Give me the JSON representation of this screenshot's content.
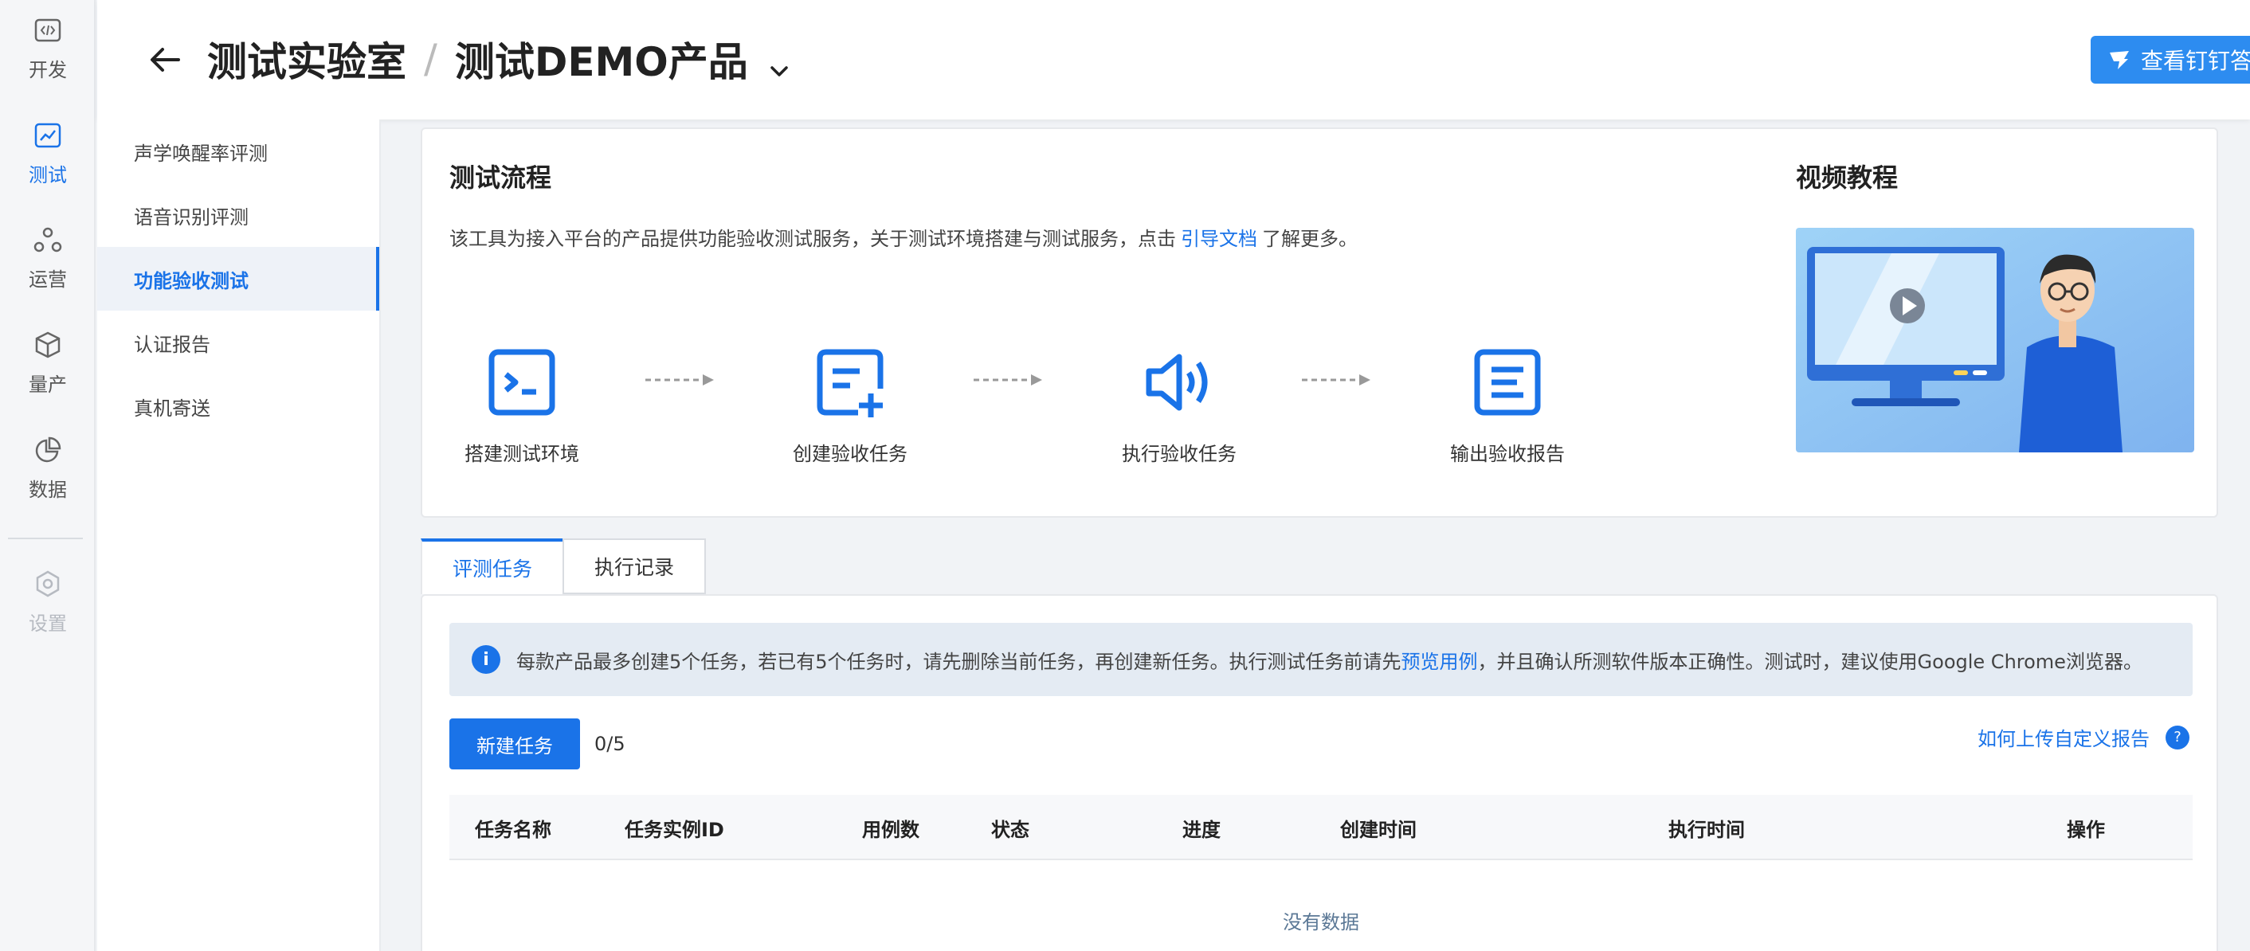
{
  "rail": {
    "items": [
      {
        "label": "开发",
        "icon": "code-icon"
      },
      {
        "label": "测试",
        "icon": "chart-line-icon",
        "active": true
      },
      {
        "label": "运营",
        "icon": "network-icon"
      },
      {
        "label": "量产",
        "icon": "cube-icon"
      },
      {
        "label": "数据",
        "icon": "pie-chart-icon"
      },
      {
        "label": "设置",
        "icon": "gear-icon",
        "disabled": true
      }
    ]
  },
  "header": {
    "crumb_root": "测试实验室",
    "separator": "/",
    "crumb_product": "测试DEMO产品",
    "qa_button": "查看钉钉答疑群"
  },
  "subnav": {
    "items": [
      "声学唤醒率评测",
      "语音识别评测",
      "功能验收测试",
      "认证报告",
      "真机寄送"
    ],
    "active_index": 2
  },
  "flow": {
    "title": "测试流程",
    "intro_prefix": "该工具为接入平台的产品提供功能验收测试服务，关于测试环境搭建与测试服务，点击",
    "intro_link": "引导文档",
    "intro_suffix": "了解更多。",
    "steps": [
      {
        "label": "搭建测试环境",
        "icon": "terminal-icon"
      },
      {
        "label": "创建验收任务",
        "icon": "add-document-icon"
      },
      {
        "label": "执行验收任务",
        "icon": "speaker-icon"
      },
      {
        "label": "输出验收报告",
        "icon": "report-icon"
      }
    ],
    "video_title": "视频教程"
  },
  "tabs": {
    "active": "评测任务",
    "inactive": "执行记录"
  },
  "tasks": {
    "notice_prefix": "每款产品最多创建5个任务，若已有5个任务时，请先删除当前任务，再创建新任务。执行测试任务前请先",
    "notice_link": "预览用例",
    "notice_suffix": "，并且确认所测软件版本正确性。测试时，建议使用Google Chrome浏览器。",
    "new_button": "新建任务",
    "count": "0/5",
    "help_link": "如何上传自定义报告",
    "help_icon": "?",
    "columns": [
      "任务名称",
      "任务实例ID",
      "用例数",
      "状态",
      "进度",
      "创建时间",
      "执行时间",
      "操作"
    ],
    "empty_text": "没有数据"
  },
  "colors": {
    "accent": "#1a73e8",
    "qa_button": "#2d8cf0"
  }
}
